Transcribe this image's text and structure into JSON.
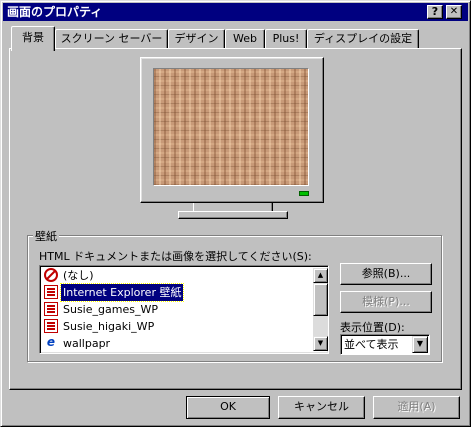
{
  "window": {
    "title": "画面のプロパティ",
    "help_label": "?",
    "close_label": "✕"
  },
  "tabs": [
    {
      "label": "背景",
      "active": true
    },
    {
      "label": "スクリーン セーバー",
      "active": false
    },
    {
      "label": "デザイン",
      "active": false
    },
    {
      "label": "Web",
      "active": false
    },
    {
      "label": "Plus!",
      "active": false
    },
    {
      "label": "ディスプレイの設定",
      "active": false
    }
  ],
  "wallpaper": {
    "group_label": "壁紙",
    "prompt": "HTML ドキュメントまたは画像を選択してください(S):",
    "items": [
      {
        "label": "(なし)",
        "icon": "no-icon"
      },
      {
        "label": "Internet Explorer 壁紙",
        "icon": "document-icon",
        "selected": true
      },
      {
        "label": "Susie_games_WP",
        "icon": "document-icon"
      },
      {
        "label": "Susie_higaki_WP",
        "icon": "document-icon"
      },
      {
        "label": "wallpapr",
        "icon": "internet-explorer-icon"
      }
    ],
    "browse_label": "参照(B)...",
    "pattern_label": "模様(P)...",
    "position_label": "表示位置(D):",
    "position_value": "並べて表示"
  },
  "buttons": {
    "ok": "OK",
    "cancel": "キャンセル",
    "apply": "適用(A)"
  },
  "scroll": {
    "up_glyph": "▲",
    "down_glyph": "▼",
    "dropdown_glyph": "▼"
  }
}
